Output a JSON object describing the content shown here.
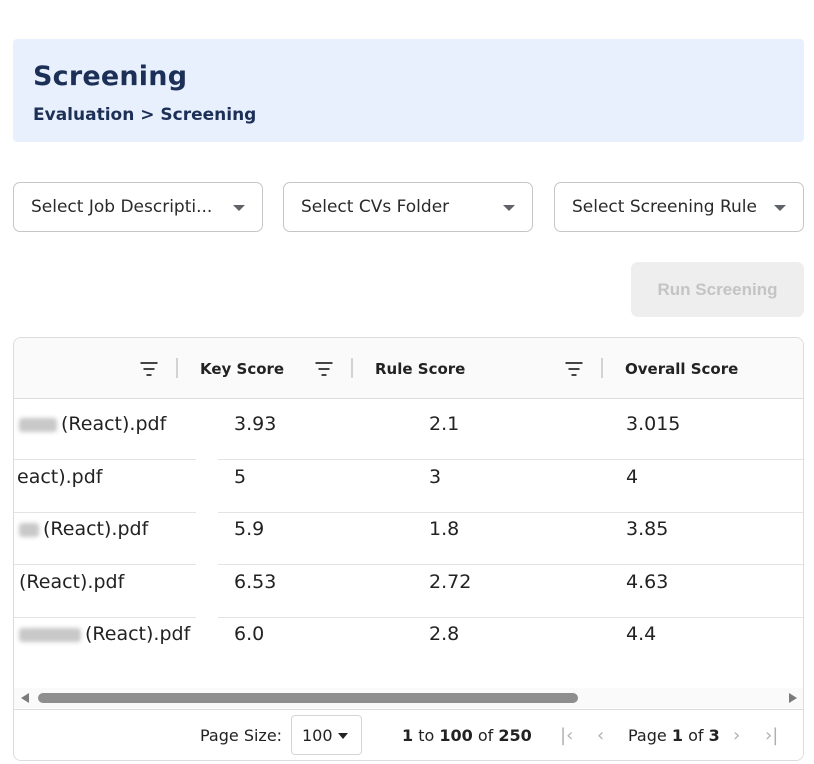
{
  "header": {
    "title": "Screening",
    "breadcrumb": "Evaluation > Screening"
  },
  "filters": {
    "job_description": "Select Job Descripti...",
    "cvs_folder": "Select CVs Folder",
    "screening_rule": "Select Screening Rule"
  },
  "run_button_label": "Run Screening",
  "grid": {
    "columns": [
      "Key Score",
      "Rule Score",
      "Overall Score"
    ],
    "rows": [
      {
        "name": "(React).pdf",
        "key_score": "3.93",
        "rule_score": "2.1",
        "overall": "3.015"
      },
      {
        "name": "eact).pdf",
        "key_score": "5",
        "rule_score": "3",
        "overall": "4"
      },
      {
        "name": "(React).pdf",
        "key_score": "5.9",
        "rule_score": "1.8",
        "overall": "3.85"
      },
      {
        "name": "(React).pdf",
        "key_score": "6.53",
        "rule_score": "2.72",
        "overall": "4.63"
      },
      {
        "name": "(React).pdf",
        "key_score": "6.0",
        "rule_score": "2.8",
        "overall": "4.4"
      }
    ]
  },
  "pagination": {
    "page_size_label": "Page Size:",
    "page_size_value": "100",
    "range_from": "1",
    "range_to_word": "to",
    "range_to": "100",
    "range_of_word": "of",
    "range_total": "250",
    "page_word": "Page",
    "page_current": "1",
    "page_of_word": "of",
    "page_total": "3"
  },
  "icons": [
    "filter-icon",
    "chevron-down-icon",
    "first-page-icon",
    "prev-page-icon",
    "next-page-icon",
    "last-page-icon"
  ]
}
